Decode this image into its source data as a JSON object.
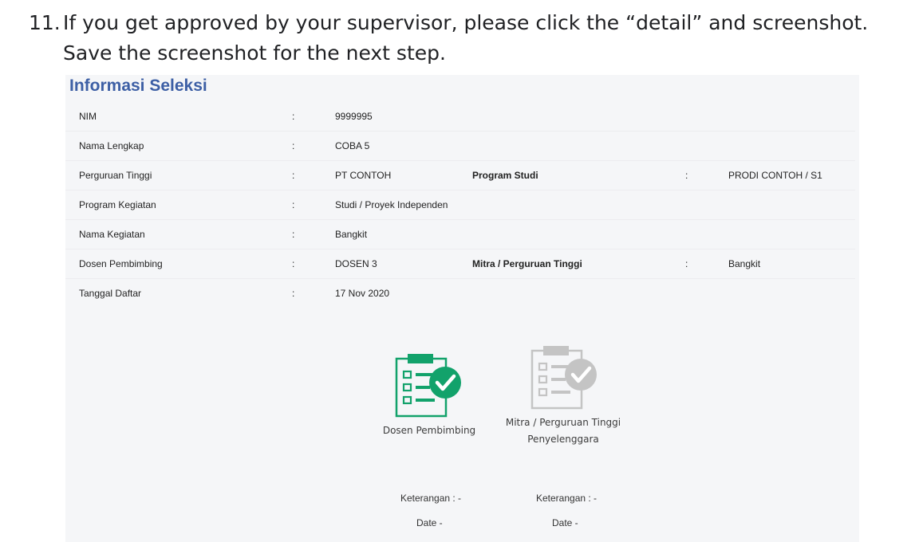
{
  "instruction": {
    "number": "11.",
    "text": "If you get approved by your supervisor, please click the “detail” and screenshot. Save the screenshot for the next step."
  },
  "panel": {
    "title": "Informasi Seleksi",
    "rows": [
      {
        "label": "NIM",
        "colon": ":",
        "value": "9999995"
      },
      {
        "label": "Nama Lengkap",
        "colon": ":",
        "value": "COBA 5"
      },
      {
        "label": "Perguruan Tinggi",
        "colon": ":",
        "value": "PT CONTOH",
        "label2": "Program Studi",
        "colon2": ":",
        "value2": "PRODI CONTOH / S1"
      },
      {
        "label": "Program Kegiatan",
        "colon": ":",
        "value": "Studi / Proyek Independen"
      },
      {
        "label": "Nama Kegiatan",
        "colon": ":",
        "value": "Bangkit"
      },
      {
        "label": "Dosen Pembimbing",
        "colon": ":",
        "value": "DOSEN 3",
        "label2": "Mitra / Perguruan Tinggi",
        "colon2": ":",
        "value2": "Bangkit"
      },
      {
        "label": "Tanggal Daftar",
        "colon": ":",
        "value": "17 Nov 2020"
      }
    ]
  },
  "approvals": [
    {
      "caption": "Dosen Pembimbing",
      "status": "approved",
      "color": "#12a26b",
      "icon": "clipboard-check-icon",
      "keterangan": "Keterangan : -",
      "date": "Date -"
    },
    {
      "caption_line1": "Mitra / Perguruan Tinggi",
      "caption_line2": "Penyelenggara",
      "status": "pending",
      "color": "#c4c4c4",
      "icon": "clipboard-check-icon",
      "keterangan": "Keterangan : -",
      "date": "Date -"
    }
  ]
}
